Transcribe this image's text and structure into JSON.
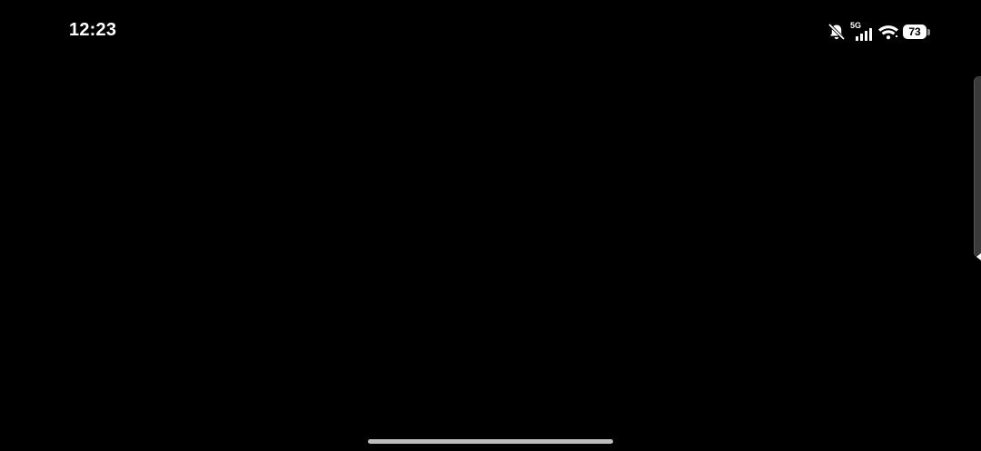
{
  "status_bar": {
    "time": "12:23",
    "network_type": "5G",
    "battery_percent": "73",
    "icons": [
      "muted-bell-icon",
      "cell-signal-icon",
      "wifi-icon",
      "battery-icon"
    ]
  },
  "colors": {
    "background": "#000000",
    "foreground": "#ffffff",
    "home_indicator": "#bdbdbd"
  }
}
